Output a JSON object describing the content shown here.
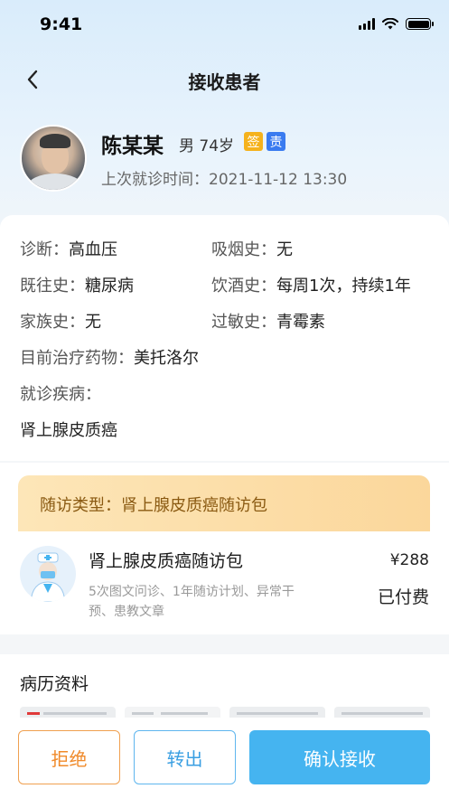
{
  "status_bar": {
    "time": "9:41"
  },
  "nav": {
    "title": "接收患者",
    "back_icon": "chevron-left-icon"
  },
  "patient": {
    "name": "陈某某",
    "meta": "男 74岁",
    "badges": [
      "签",
      "责"
    ],
    "last_visit": "上次就诊时间：2021-11-12 13:30"
  },
  "info": {
    "diagnosis": {
      "label": "诊断：",
      "value": "高血压"
    },
    "smoking": {
      "label": "吸烟史：",
      "value": "无"
    },
    "past_history": {
      "label": "既往史：",
      "value": "糖尿病"
    },
    "drinking": {
      "label": "饮酒史：",
      "value": "每周1次，持续1年"
    },
    "family_history": {
      "label": "家族史：",
      "value": "无"
    },
    "allergy": {
      "label": "过敏史：",
      "value": "青霉素"
    },
    "current_meds": {
      "label": "目前治疗药物：",
      "value": "美托洛尔"
    },
    "visit_disease_label": "就诊疾病：",
    "visit_disease_value": "肾上腺皮质癌"
  },
  "followup": {
    "type_text": "随访类型：肾上腺皮质癌随访包",
    "package_name": "肾上腺皮质癌随访包",
    "package_desc": "5次图文问诊、1年随访计划、异常干预、患教文章",
    "price": "¥288",
    "status": "已付费"
  },
  "records": {
    "title": "病历资料"
  },
  "actions": {
    "reject": "拒绝",
    "transfer": "转出",
    "confirm": "确认接收"
  },
  "colors": {
    "accent": "#45b4f0",
    "reject": "#f08a2a",
    "badge_sign": "#f5b21d",
    "badge_duty": "#3a7bf0"
  }
}
